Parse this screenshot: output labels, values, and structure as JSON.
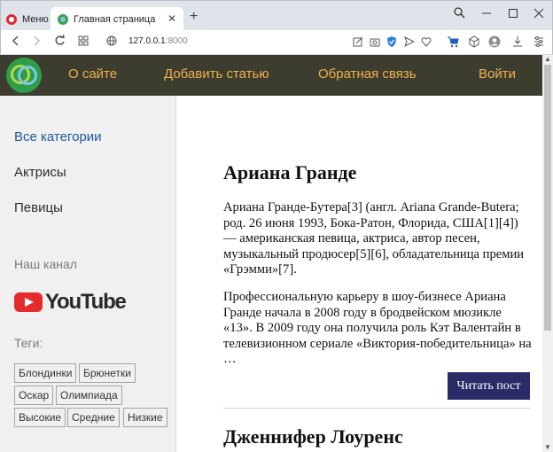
{
  "browser": {
    "menu_tab": "Меню",
    "active_tab": "Главная страница",
    "close_glyph": "✕",
    "new_tab_glyph": "+",
    "url_host": "127.0.0.1",
    "url_port": ":8000"
  },
  "site": {
    "nav": [
      "О сайте",
      "Добавить статью",
      "Обратная связь",
      "Войти"
    ]
  },
  "sidebar": {
    "categories": [
      "Все категории",
      "Актрисы",
      "Певицы"
    ],
    "channel_heading": "Наш канал",
    "youtube_text": "YouTube",
    "tags_heading": "Теги:",
    "tags": [
      "Блондинки",
      "Брюнетки",
      "Оскар",
      "Олимпиада",
      "Высокие",
      "Средние",
      "Низкие"
    ]
  },
  "posts": [
    {
      "title": "Ариана Гранде",
      "para1": "Ариана Гранде-Бутера[3] (англ. Ariana Grande-Butera; род. 26 июня 1993, Бока-Ратон, Флорида, США[1][4]) — американская певица, актриса, автор песен, музыкальный продюсер[5][6], обладательница премии «Грэмми»[7].",
      "para2": "Профессиональную карьеру в шоу-бизнесе Ариана Гранде начала в 2008 году в бродвейском мюзикле «13». В 2009 году она получила роль Кэт Валентайн в телевизионном сериале «Виктория-победительница» на …",
      "button": "Читать пост"
    },
    {
      "title": "Дженнифер Лоуренс"
    }
  ],
  "colors": {
    "header_bg": "#3d3d2f",
    "nav_link": "#f0b04c",
    "active_category": "#1e5a9a",
    "read_button": "#2b2b68",
    "sidebar_bg": "#f0f0f0"
  }
}
